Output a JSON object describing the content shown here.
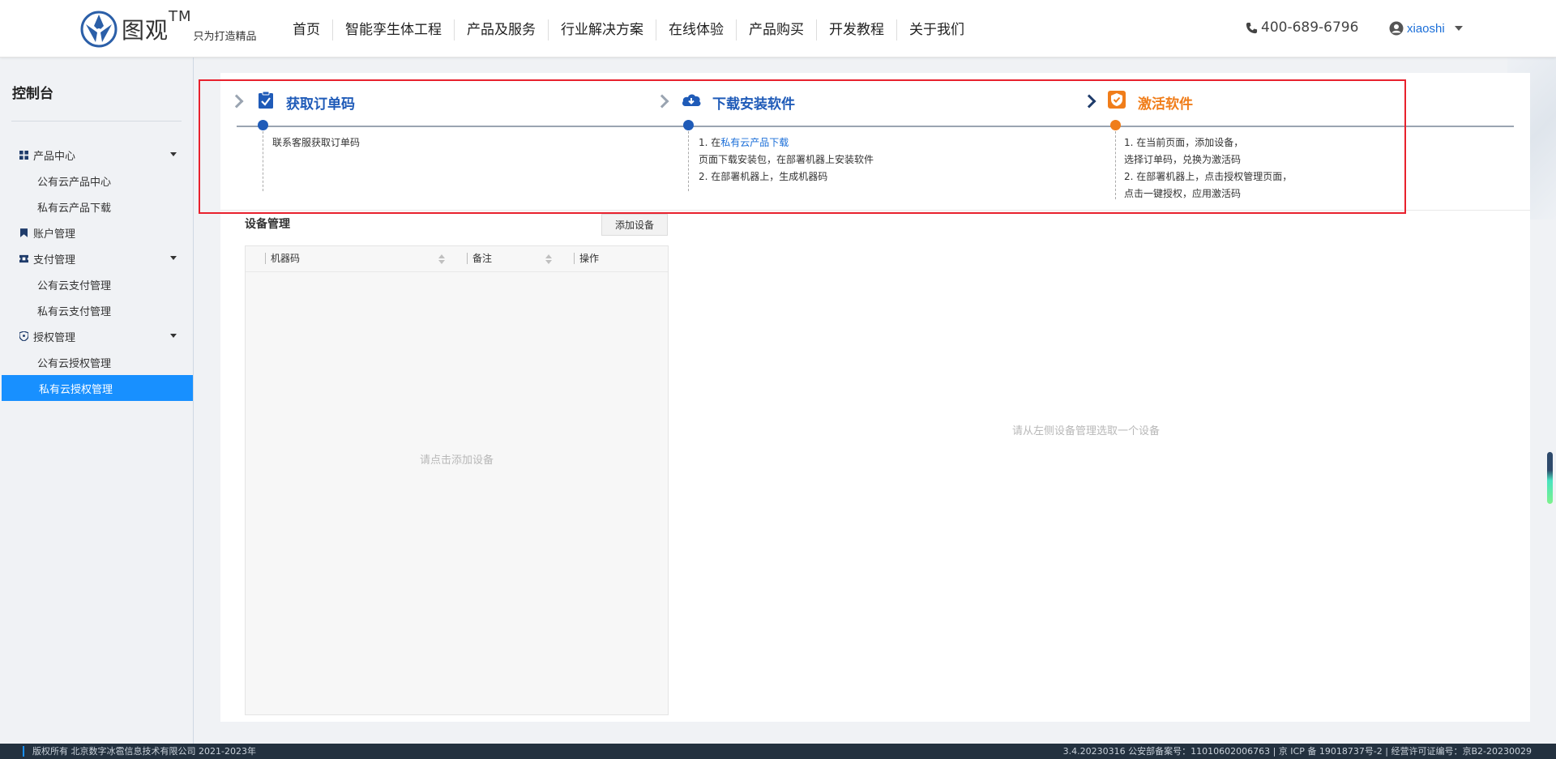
{
  "header": {
    "logo_text": "图观",
    "logo_tm": "TM",
    "logo_slogan": "只为打造精品",
    "nav": [
      "首页",
      "智能孪生体工程",
      "产品及服务",
      "行业解决方案",
      "在线体验",
      "产品购买",
      "开发教程",
      "关于我们"
    ],
    "phone": "400-689-6796",
    "username": "xiaoshi"
  },
  "sidebar": {
    "title": "控制台",
    "groups": [
      {
        "label": "产品中心",
        "items": [
          "公有云产品中心",
          "私有云产品下载"
        ]
      },
      {
        "label": "账户管理",
        "items": []
      },
      {
        "label": "支付管理",
        "items": [
          "公有云支付管理",
          "私有云支付管理"
        ]
      },
      {
        "label": "授权管理",
        "items": [
          "公有云授权管理",
          "私有云授权管理"
        ]
      }
    ],
    "active_item": "私有云授权管理"
  },
  "steps": [
    {
      "title": "获取订单码",
      "lines": [
        "联系客服获取订单码"
      ]
    },
    {
      "title": "下载安装软件",
      "line1_prefix": "1. 在",
      "line1_link": "私有云产品下载",
      "lines": [
        "页面下载安装包，在部署机器上安装软件",
        "2. 在部署机器上，生成机器码"
      ]
    },
    {
      "title": "激活软件",
      "lines": [
        "1. 在当前页面，添加设备，",
        "选择订单码，兑换为激活码",
        "2. 在部署机器上，点击授权管理页面，",
        "点击一键授权，应用激活码"
      ]
    }
  ],
  "device_management": {
    "title": "设备管理",
    "add_button": "添加设备",
    "columns": [
      "机器码",
      "备注",
      "操作"
    ],
    "empty_text": "请点击添加设备",
    "detail_empty_text": "请从左侧设备管理选取一个设备"
  },
  "footer": {
    "left": "版权所有 北京数字冰雹信息技术有限公司 2021-2023年",
    "right": "3.4.20230316 公安部备案号：11010602006763 | 京 ICP 备 19018737号-2 | 经营许可证编号：京B2-20230029"
  },
  "colors": {
    "primary": "#1f5bb8",
    "accent_orange": "#f07d1a",
    "active_blue": "#1890ff",
    "highlight_red": "#e8212d"
  }
}
